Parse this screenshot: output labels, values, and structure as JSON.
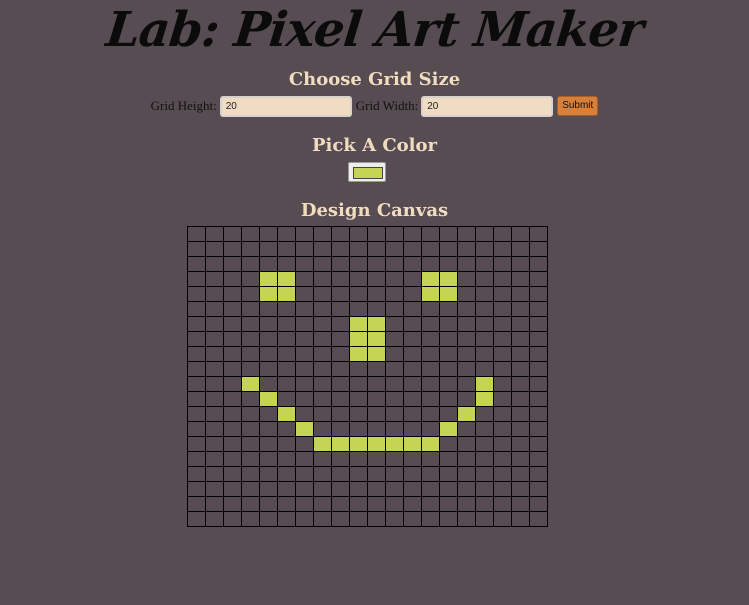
{
  "title": "Lab: Pixel Art Maker",
  "grid_size": {
    "heading": "Choose Grid Size",
    "height_label": "Grid Height:",
    "height_value": "20",
    "width_label": "Grid Width:",
    "width_value": "20",
    "submit_label": "Submit"
  },
  "color_section": {
    "heading": "Pick A Color",
    "selected_color": "#c5d453"
  },
  "canvas_section": {
    "heading": "Design Canvas",
    "rows": 20,
    "cols": 20,
    "painted_cells": [
      [
        3,
        4
      ],
      [
        3,
        5
      ],
      [
        3,
        13
      ],
      [
        3,
        14
      ],
      [
        4,
        4
      ],
      [
        4,
        5
      ],
      [
        4,
        13
      ],
      [
        4,
        14
      ],
      [
        6,
        9
      ],
      [
        6,
        10
      ],
      [
        7,
        9
      ],
      [
        7,
        10
      ],
      [
        8,
        9
      ],
      [
        8,
        10
      ],
      [
        10,
        3
      ],
      [
        10,
        16
      ],
      [
        11,
        4
      ],
      [
        11,
        16
      ],
      [
        12,
        5
      ],
      [
        12,
        15
      ],
      [
        13,
        6
      ],
      [
        13,
        14
      ],
      [
        14,
        7
      ],
      [
        14,
        8
      ],
      [
        14,
        9
      ],
      [
        14,
        10
      ],
      [
        14,
        11
      ],
      [
        14,
        12
      ],
      [
        14,
        13
      ]
    ]
  },
  "colors": {
    "background": "#564c51",
    "heading": "#f2dcc0",
    "paint": "#c5d453",
    "submit": "#d6803c"
  }
}
